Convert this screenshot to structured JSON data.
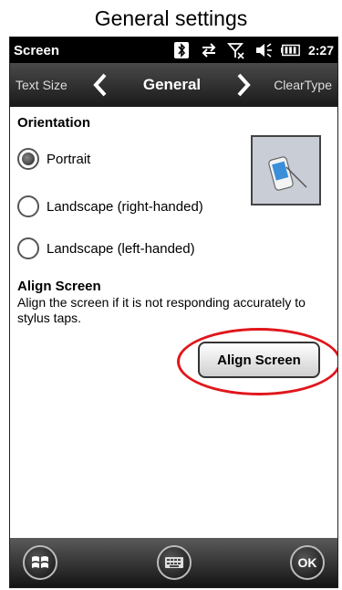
{
  "caption": "General settings",
  "status_bar": {
    "title": "Screen",
    "time": "2:27",
    "icons": [
      "bluetooth-icon",
      "data-sync-icon",
      "no-signal-icon",
      "volume-icon",
      "battery-icon"
    ]
  },
  "tabs": {
    "previous": "Text Size",
    "current": "General",
    "next": "ClearType"
  },
  "orientation": {
    "title": "Orientation",
    "selected": "Portrait",
    "options": [
      "Portrait",
      "Landscape (right-handed)",
      "Landscape (left-handed)"
    ]
  },
  "align": {
    "title": "Align Screen",
    "description": "Align the screen if it is not responding accurately to stylus taps.",
    "button_label": "Align Screen"
  },
  "softkeys": {
    "start_icon": "windows-start-icon",
    "keyboard_icon": "keyboard-icon",
    "ok_label": "OK"
  },
  "colors": {
    "highlight": "#e0161c",
    "statusbar": "#000000"
  }
}
